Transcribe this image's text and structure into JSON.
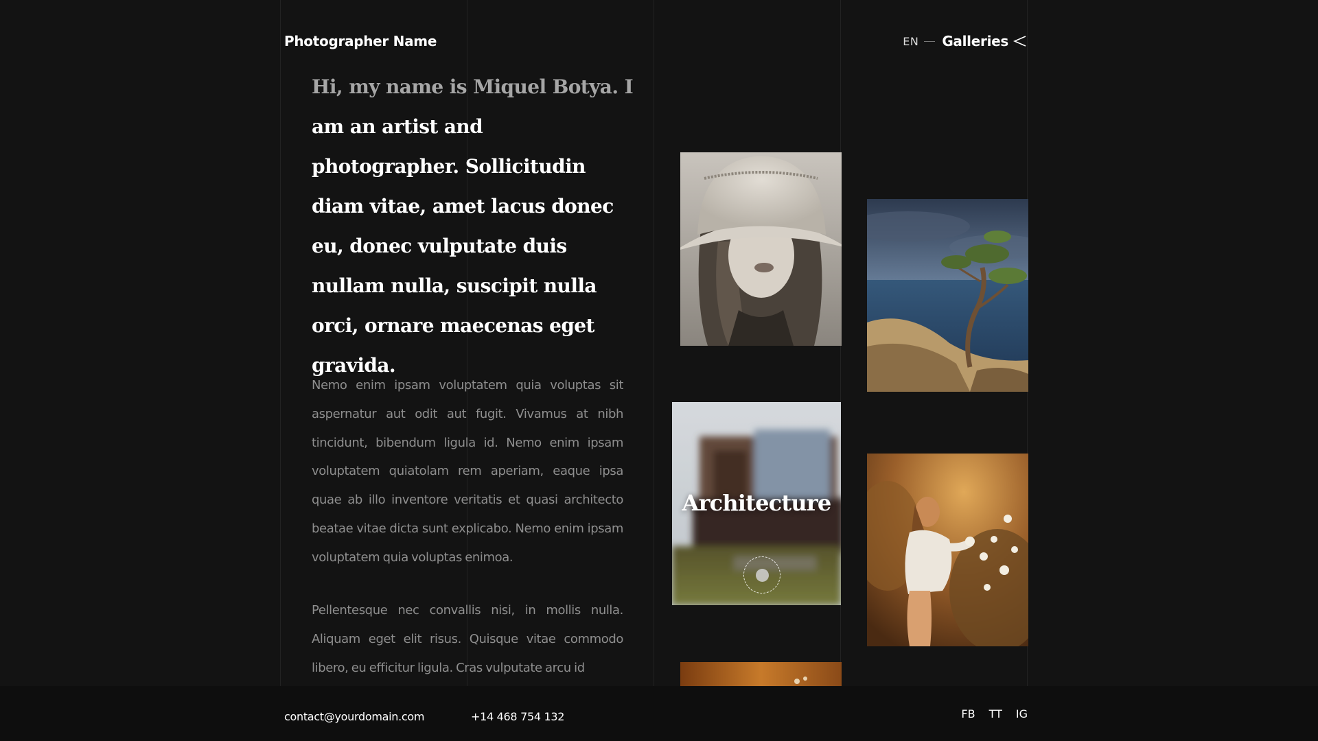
{
  "header": {
    "brand": "Photographer Name",
    "language": "EN",
    "galleries_label": "Galleries"
  },
  "intro": {
    "headline_lead": "Hi, my name is Miquel Botya. I",
    "headline_rest": " am an artist and photographer. Sollicitudin diam vitae, amet lacus donec eu, donec vulputate duis nullam nulla, suscipit nulla orci, ornare maecenas eget gravida.",
    "paragraph_1": "Nemo enim ipsam voluptatem quia voluptas sit aspernatur aut odit aut fugit. Vivamus at nibh tincidunt, bibendum ligula id. Nemo enim ipsam voluptatem quiatolam rem aperiam, eaque ipsa quae ab illo inventore veritatis et quasi architecto beatae vitae dicta sunt explicabo. Nemo enim ipsam voluptatem quia voluptas enimoa.",
    "paragraph_2": "Pellentesque nec convallis nisi, in mollis nulla. Aliquam eget elit risus. Quisque vitae commodo libero, eu efficitur ligula. Cras vulputate arcu id"
  },
  "gallery": {
    "hovered_label": "Architecture",
    "tiles": [
      "portrait-photo",
      "coast-tree-photo",
      "architecture-photo",
      "woman-field-photo",
      "partial-photo"
    ]
  },
  "footer": {
    "email": "contact@yourdomain.com",
    "phone": "+14 468 754 132",
    "social": [
      "FB",
      "TT",
      "IG"
    ]
  },
  "colors": {
    "background": "#131313",
    "footer_background": "#0e0e0e",
    "headline_muted": "#a6a6a6",
    "body_text": "#8e8e8e",
    "grid_line": "#222222"
  }
}
